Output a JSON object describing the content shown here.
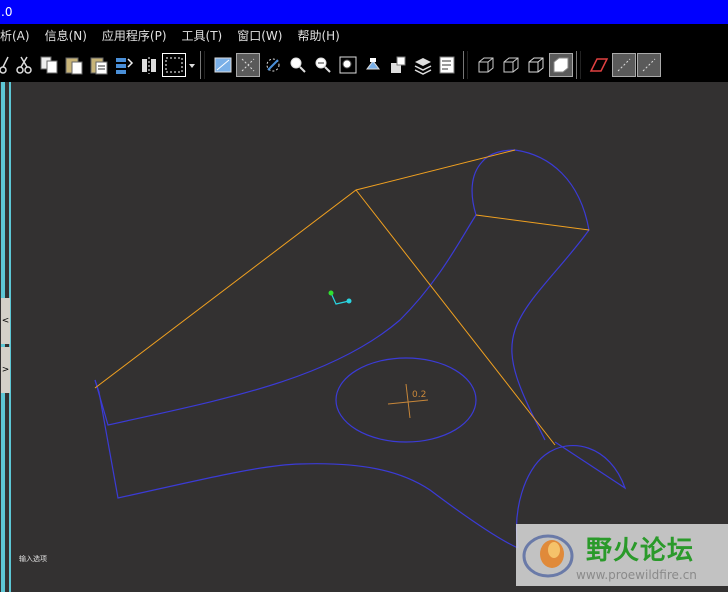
{
  "window": {
    "title": ".0"
  },
  "menu": [
    "析(A)",
    "信息(N)",
    "应用程序(P)",
    "工具(T)",
    "窗口(W)",
    "帮助(H)"
  ],
  "toolbar": {
    "icons": [
      "cut-icon",
      "copy-icon",
      "paste-icon",
      "paste-special-icon",
      "regenerate-icon",
      "mirror-icon",
      "select-box-icon"
    ]
  },
  "left_tabs": [
    "<",
    ">"
  ],
  "status": {
    "text": "输入选项"
  },
  "dimension": {
    "label": "0.2"
  },
  "watermark": {
    "title": "野火论坛",
    "url": "www.proewildfire.cn"
  },
  "colors": {
    "title_bar": "#0000ff",
    "datum_curve": "#3b3bd6",
    "edge": "#f0a020",
    "canvas": "#333131",
    "csys": "#2ad4e0"
  }
}
